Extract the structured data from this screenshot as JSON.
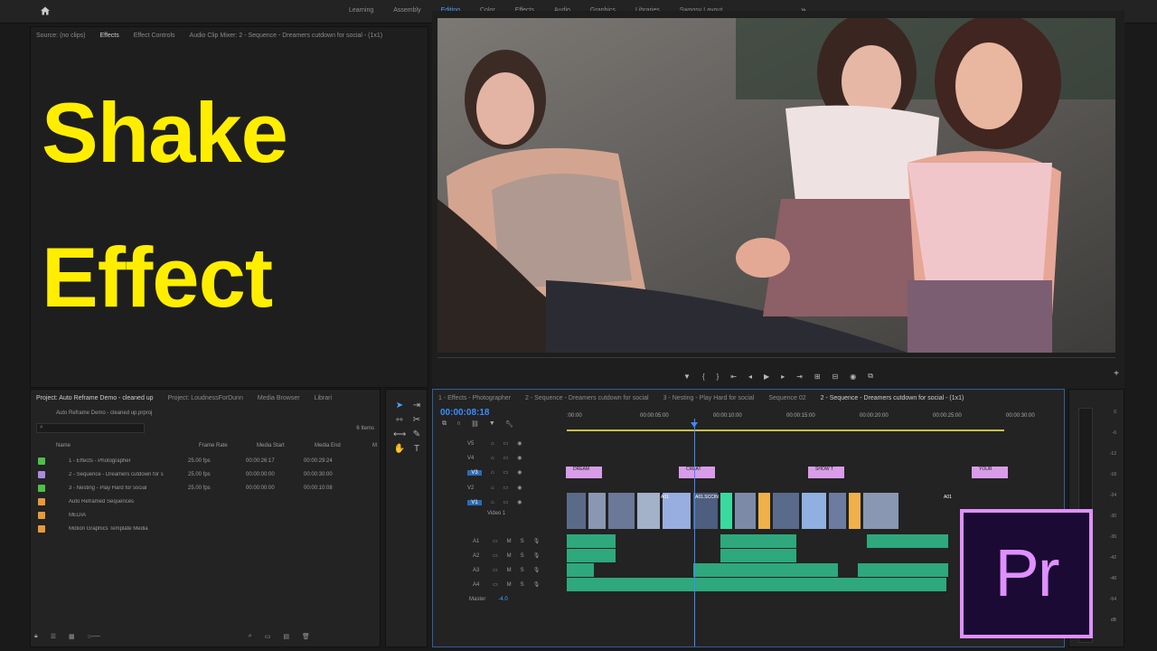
{
  "workspace_tabs": [
    "Learning",
    "Assembly",
    "Editing",
    "Color",
    "Effects",
    "Audio",
    "Graphics",
    "Libraries",
    "Swoosy Layout"
  ],
  "active_workspace": "Editing",
  "source_tabs": [
    "Source: (no clips)",
    "Effects",
    "Effect Controls",
    "Audio Clip Mixer: 2 - Sequence - Dreamers cutdown for social - (1x1)"
  ],
  "overlay_title_line1": "Shake",
  "overlay_title_line2": "Effect",
  "project": {
    "tabs": [
      "Project: Auto Reframe Demo - cleaned up",
      "Project: LoudnessForDunn",
      "Media Browser",
      "Librari"
    ],
    "path": "Auto Reframe Demo - cleaned up.prproj",
    "items_count": "6 Items",
    "columns": [
      "Name",
      "Frame Rate",
      "Media Start",
      "Media End",
      "M"
    ],
    "rows": [
      {
        "name": "1 - Effects - Photographer",
        "fps": "25.00 fps",
        "start": "00:00:26:17",
        "end": "00:00:29:24",
        "color": "#4fbf4a"
      },
      {
        "name": "2 - Sequence - Dreamers cutdown for s",
        "fps": "25.00 fps",
        "start": "00:00:00:00",
        "end": "00:00:30:00",
        "color": "#a88be0"
      },
      {
        "name": "3 - Nesting - Play Hard for social",
        "fps": "25.00 fps",
        "start": "00:00:00:00",
        "end": "00:00:10:08",
        "color": "#4fbf4a"
      },
      {
        "name": "Auto Reframed Sequences",
        "fps": "",
        "start": "",
        "end": "",
        "color": "#e69a3a"
      },
      {
        "name": "MEDIA",
        "fps": "",
        "start": "",
        "end": "",
        "color": "#e69a3a"
      },
      {
        "name": "Motion Graphics Template Media",
        "fps": "",
        "start": "",
        "end": "",
        "color": "#e69a3a"
      }
    ]
  },
  "timeline": {
    "tabs": [
      "1 - Effects - Photographer",
      "2 - Sequence - Dreamers cutdown for social",
      "3 - Nesting - Play Hard for social",
      "Sequence 02",
      "2 - Sequence - Dreamers cutdown for social - (1x1)"
    ],
    "timecode": "00:00:08:18",
    "ruler": [
      ":00:00",
      "00:00:05:00",
      "00:00:10:00",
      "00:00:15:00",
      "00:00:20:00",
      "00:00:25:00",
      "00:00:30:00"
    ],
    "video_tracks": [
      "V5",
      "V4",
      "V3",
      "V2",
      "V1"
    ],
    "video1_label": "Video 1",
    "audio_tracks": [
      "A1",
      "A2",
      "A3",
      "A4"
    ],
    "master_label": "Master",
    "master_value": "-4.0",
    "v3_clips": [
      "DREAM",
      "CREAT",
      "SHOW T",
      "YOUR"
    ],
    "v1_labels": [
      "A01",
      "A01.SCCIN",
      "A01"
    ]
  },
  "meters": [
    "0",
    "-6",
    "-12",
    "-18",
    "-24",
    "-30",
    "-36",
    "-42",
    "-48",
    "-54",
    "dB"
  ],
  "logo_text": "Pr"
}
